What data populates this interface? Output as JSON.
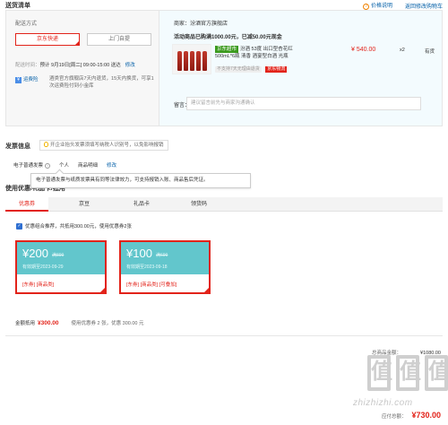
{
  "header": {
    "title": "送货清单",
    "price_help": "价格说明",
    "back_link": "返回修改购物车"
  },
  "shipping": {
    "label": "配送方式",
    "methods": [
      "京东快递",
      "上门自提"
    ],
    "selected_method": "京东快递",
    "time_label": "配送时间：",
    "time_value": "预计 9月19日[周二] 09:00-15:00 送达",
    "time_edit": "修改",
    "service_label": "运费险",
    "service_desc": "酒类官方旗舰店7天内退货，15天内换货，可享1次运费险付到小金库"
  },
  "shop": {
    "name": "商家：汾酒官方旗舰店",
    "promo": "活动商品已购满1000.00元，已减50.00元现金",
    "product_tag": "京东超市",
    "product_name": "汾酒 53度 出口型杏花红 500mL*6瓶 清香 酒宴型白酒 光瓶",
    "price": "¥ 540.00",
    "qty": "x2",
    "stock": "有货",
    "no_return_tag": "不支持7天无理由退货",
    "logistics_tag": "京东物流",
    "remark_label": "留言：",
    "remark_placeholder": "建议留言前先与商家沟通确认"
  },
  "invoice": {
    "title": "发票信息",
    "tip": "开企业抬头发票须填写纳税人识别号，以免影响报销",
    "type": "电子普通发票",
    "holder": "个人",
    "content": "商品明细",
    "edit": "修改",
    "tooltip": "电子普通发票与纸质发票具有同等法律效力，可支持报销入账、商品售后凭证。"
  },
  "coupons": {
    "section_title": "使用优惠/礼品卡/抵用",
    "tabs": [
      "优惠券",
      "京豆",
      "礼品卡",
      "领货码"
    ],
    "active_tab": "优惠券",
    "optimal_text": "优惠组合推荐，共抵用300.00元，使用优惠券2张",
    "list": [
      {
        "amount": "¥200",
        "condition": "满899",
        "date": "有效期至2023-09-29",
        "tags": "[东券] [商品类]"
      },
      {
        "amount": "¥100",
        "condition": "满699",
        "date": "有效期至2023-09-18",
        "tags": "[东券] [商品类] [可叠加]"
      }
    ],
    "summary_label": "金额抵用",
    "summary_amount": "¥300.00",
    "summary_rest": "使用优惠券 2 张，优惠 300.00 元"
  },
  "totals": {
    "goods_label": "总商品金额：",
    "goods_value": "¥1080.00",
    "pay_label": "应付总额：",
    "pay_value": "¥730.00"
  },
  "watermark": {
    "text": "zhizhizhi.com",
    "glyph": "值"
  },
  "colors": {
    "accent": "#e2231a",
    "link": "#005ea7",
    "coupon_bg": "#62c6cc",
    "tag_green": "#3a9a1d"
  }
}
